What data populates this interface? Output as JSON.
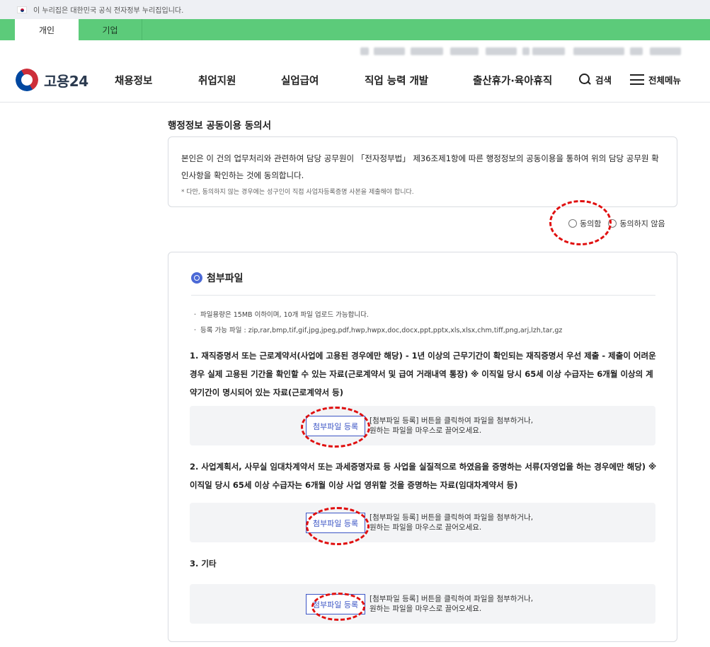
{
  "gov_banner": {
    "text": "이 누리집은 대한민국 공식 전자정부 누리집입니다."
  },
  "top_tabs": [
    {
      "label": "개인",
      "active": true
    },
    {
      "label": "기업",
      "active": false
    }
  ],
  "header": {
    "logo_text": "고용24",
    "nav": [
      "채용정보",
      "취업지원",
      "실업급여",
      "직업 능력 개발",
      "출산휴가·육아휴직"
    ],
    "search_label": "검색",
    "menu_label": "전체메뉴"
  },
  "consent": {
    "title": "행정정보 공동이용 동의서",
    "body": "본인은 이 건의 업무처리와 관련하여 담당 공무원이 「전자정부법」 제36조제1항에 따른 행정정보의 공동이용을 통하여 위의 담당 공무원 확인사항을 확인하는 것에 동의합니다.",
    "note": "* 다만, 동의하지 않는 경우에는 성구인이 직접 사업자등록증명 사본을 제출해야 합니다.",
    "options": [
      "동의함",
      "동의하지 않음"
    ]
  },
  "attachments": {
    "title": "첨부파일",
    "info": [
      "파일용량은 15MB 이하이며, 10개 파일 업로드 가능합니다.",
      "등록 가능 파일 : zip,rar,bmp,tif,gif,jpg,jpeg,pdf,hwp,hwpx,doc,docx,ppt,pptx,xls,xlsx,chm,tiff,png,arj,lzh,tar,gz"
    ],
    "items": [
      {
        "text": "1. 재직증명서 또는 근로계약서(사업에 고용된 경우에만 해당) - 1년 이상의 근무기간이 확인되는 재직증명서 우선 제출 - 제출이 어려운 경우 실제 고용된 기간을 확인할 수 있는 자료(근로계약서 및 급여 거래내역 통장) ※ 이직일 당시 65세 이상 수급자는 6개월 이상의 계약기간이 명시되어 있는 자료(근로계약서 등)"
      },
      {
        "text": "2. 사업계획서, 사무실 임대차계약서 또는 과세증명자료 등 사업을 실질적으로 하였음을 증명하는 서류(자영업을 하는 경우에만 해당) ※ 이직일 당시 65세 이상 수급자는 6개월 이상 사업 영위할 것을 증명하는 자료(임대차계약서 등)"
      },
      {
        "text": "3. 기타"
      }
    ],
    "button_label": "첨부파일 등록",
    "drop_text_line1": "[첨부파일 등록] 버튼을 클릭하여 파일을 첨부하거나,",
    "drop_text_line2": "원하는 파일을 마우스로 끌어오세요."
  }
}
